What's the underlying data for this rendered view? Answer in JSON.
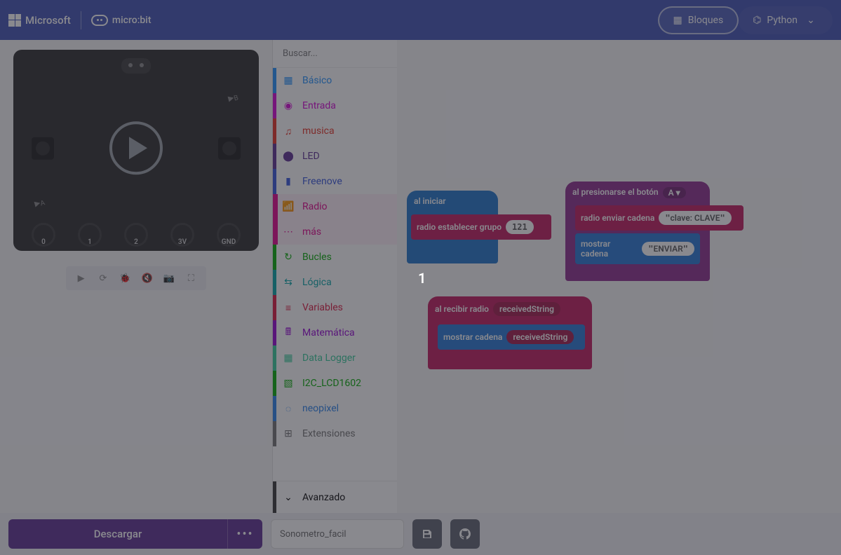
{
  "header": {
    "microsoft": "Microsoft",
    "microbit": "micro:bit",
    "blocks_label": "Bloques",
    "python_label": "Python"
  },
  "search": {
    "placeholder": "Buscar..."
  },
  "categories": [
    {
      "label": "Básico",
      "color": "#1e90ff",
      "icon": "▦"
    },
    {
      "label": "Entrada",
      "color": "#d400d4",
      "icon": "◉"
    },
    {
      "label": "musica",
      "color": "#e63022",
      "icon": "♫"
    },
    {
      "label": "LED",
      "color": "#5c2d91",
      "icon": "⬤"
    },
    {
      "label": "Freenove",
      "color": "#3455db",
      "icon": "▮"
    },
    {
      "label": "Radio",
      "color": "#e3008c",
      "icon": "📶"
    },
    {
      "label": "más",
      "color": "#e3008c",
      "icon": "⋯"
    },
    {
      "label": "Bucles",
      "color": "#00aa00",
      "icon": "↻"
    },
    {
      "label": "Lógica",
      "color": "#00a4a6",
      "icon": "⇆"
    },
    {
      "label": "Variables",
      "color": "#dc143c",
      "icon": "≡"
    },
    {
      "label": "Matemática",
      "color": "#9400d3",
      "icon": "🖩"
    },
    {
      "label": "Data Logger",
      "color": "#33cc99",
      "icon": "▦"
    },
    {
      "label": "I2C_LCD1602",
      "color": "#00aa00",
      "icon": "▧"
    },
    {
      "label": "neopixel",
      "color": "#2680eb",
      "icon": "◌"
    },
    {
      "label": "Extensiones",
      "color": "#717171",
      "icon": "⊞"
    }
  ],
  "advanced_label": "Avanzado",
  "blocks": {
    "on_start": {
      "header": "al iniciar",
      "inner": "radio establecer grupo",
      "value": "121"
    },
    "on_button": {
      "header": "al presionarse el botón",
      "button": "A ▾",
      "send": "radio enviar cadena",
      "send_val": "clave: CLAVE",
      "show": "mostrar cadena",
      "show_val": "ENVIAR"
    },
    "on_receive": {
      "header": "al recibir radio",
      "param": "receivedString",
      "show": "mostrar cadena",
      "show_val": "receivedString"
    }
  },
  "overlay_number": "1",
  "sim_pins": [
    "0",
    "1",
    "2",
    "3V",
    "GND"
  ],
  "sim_flags": {
    "a": "A",
    "b": "B"
  },
  "footer": {
    "download": "Descargar",
    "more": "•••",
    "project_name": "Sonometro_facil"
  },
  "colors": {
    "hat_blue": "#1e74c9",
    "radio_pink": "#c2185b",
    "radio_dark": "#a31849",
    "basic_blue": "#2577d4",
    "purple_hat": "#8c2a8c"
  }
}
